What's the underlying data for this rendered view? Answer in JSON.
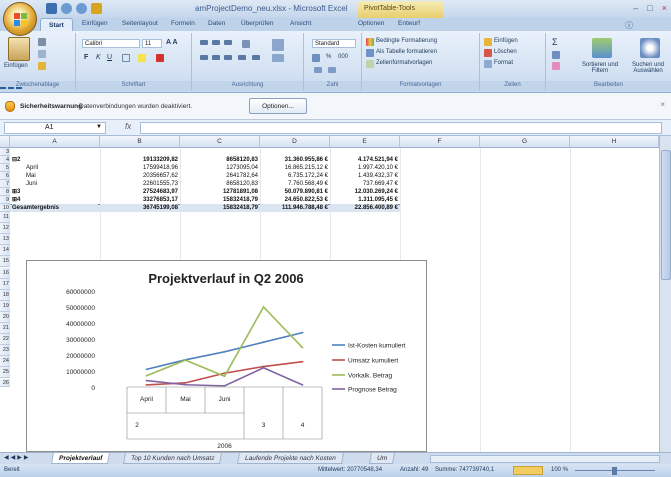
{
  "window": {
    "title": "amProjectDemo_neu.xlsx - Microsoft Excel",
    "context_label": "PivotTable-Tools",
    "minimize": "–",
    "restore": "□",
    "close": "×"
  },
  "ribbon_tabs": [
    "Start",
    "Einfügen",
    "Seitenlayout",
    "Formeln",
    "Daten",
    "Überprüfen",
    "Ansicht",
    "Optionen",
    "Entwurf"
  ],
  "ribbon": {
    "clipboard": {
      "paste": "Einfügen",
      "label": "Zwischenablage"
    },
    "font": {
      "name": "Calibri",
      "size": "11",
      "label": "Schriftart",
      "bold": "F",
      "italic": "K",
      "underline": "U"
    },
    "alignment": {
      "label": "Ausrichtung"
    },
    "number": {
      "format": "Standard",
      "label": "Zahl",
      "percent": "%",
      "thousands": "000"
    },
    "styles": {
      "conditional": "Bedingte Formatierung",
      "as_table": "Als Tabelle formatieren",
      "cell_styles": "Zellenformatvorlagen",
      "label": "Formatvorlagen"
    },
    "cells": {
      "insert": "Einfügen",
      "delete": "Löschen",
      "format": "Format",
      "label": "Zellen"
    },
    "editing": {
      "sigma": "Σ",
      "sort": "Sortieren und Filtern",
      "find": "Suchen und Auswählen",
      "label": "Bearbeiten"
    }
  },
  "security_bar": {
    "title": "Sicherheitswarnung",
    "message": "Datenverbindungen wurden deaktiviert.",
    "button": "Optionen...",
    "close": "×"
  },
  "formula_bar": {
    "cell_ref": "A1",
    "fx": "fx",
    "value": ""
  },
  "columns": [
    "A",
    "B",
    "C",
    "D",
    "E",
    "F",
    "G",
    "H"
  ],
  "rows": [
    {
      "n": "3",
      "a": "",
      "b": "",
      "c": "",
      "d": "",
      "e": "",
      "bold": false,
      "indent": false
    },
    {
      "n": "4",
      "a": "⊟2",
      "b": "19133209,82",
      "c": "8658120,83",
      "d": "31.360.955,86 €",
      "e": "4.174.521,94 €",
      "bold": true,
      "indent": false
    },
    {
      "n": "5",
      "a": "April",
      "b": "17599418,96",
      "c": "1273095,04",
      "d": "16.865.215,12 €",
      "e": "1.997.420,10 €",
      "bold": false,
      "indent": true
    },
    {
      "n": "6",
      "a": "Mai",
      "b": "20356657,62",
      "c": "2641782,64",
      "d": "6.735.172,24 €",
      "e": "1.439.432,37 €",
      "bold": false,
      "indent": true
    },
    {
      "n": "7",
      "a": "Juni",
      "b": "22601555,73",
      "c": "8658120,83",
      "d": "7.760.568,49 €",
      "e": "737.669,47 €",
      "bold": false,
      "indent": true
    },
    {
      "n": "8",
      "a": "⊞3",
      "b": "27524683,97",
      "c": "12781891,08",
      "d": "50.079.890,81 €",
      "e": "12.030.269,24 €",
      "bold": true,
      "indent": false
    },
    {
      "n": "9",
      "a": "⊞4",
      "b": "33276853,17",
      "c": "15832418,79",
      "d": "24.650.822,53 €",
      "e": "1.311.095,45 €",
      "bold": true,
      "indent": false
    },
    {
      "n": "10",
      "a": "Gesamtergebnis",
      "b": "36745199,08",
      "c": "15832418,79",
      "d": "111.946.788,48 €",
      "e": "22.856.400,89 €",
      "bold": true,
      "indent": false
    }
  ],
  "empty_rows": [
    "11",
    "12",
    "13",
    "14",
    "15",
    "16",
    "17",
    "18",
    "19",
    "20",
    "21",
    "22",
    "23",
    "24",
    "25",
    "26"
  ],
  "chart_data": {
    "type": "line",
    "title": "Projektverlauf in Q2 2006",
    "categories": [
      "April",
      "Mai",
      "Juni",
      "3",
      "4"
    ],
    "category_groups": [
      {
        "label": "2",
        "span": 3
      },
      {
        "label": "3",
        "span": 1
      },
      {
        "label": "4",
        "span": 1
      }
    ],
    "year_label": "2006",
    "ylim": [
      0,
      60000000
    ],
    "yticks": [
      "60000000",
      "50000000",
      "40000000",
      "30000000",
      "20000000",
      "10000000",
      "0"
    ],
    "series": [
      {
        "name": "Ist-Kosten kumuliert",
        "color": "#4f81bd",
        "values": [
          11000000,
          17000000,
          22000000,
          28000000,
          34000000
        ]
      },
      {
        "name": "Umsatz kumuliert",
        "color": "#c0504d",
        "values": [
          1300000,
          2600000,
          8600000,
          12800000,
          15800000
        ]
      },
      {
        "name": "Vorkalk. Betrag",
        "color": "#9bbb59",
        "values": [
          7000000,
          16800000,
          6700000,
          50000000,
          24600000
        ]
      },
      {
        "name": "Prognose Betrag",
        "color": "#8064a2",
        "values": [
          4000000,
          1400000,
          700000,
          12000000,
          1300000
        ]
      }
    ]
  },
  "sheet_tabs": [
    "Projektverlauf",
    "Top 10 Kunden nach Umsatz",
    "Laufende Projekte nach Kosten",
    "Um"
  ],
  "status": {
    "mode": "Bereit",
    "average": "Mittelwert: 20770548,34",
    "count": "Anzahl: 49",
    "sum": "Summe: 747739740,1",
    "zoom": "100 %"
  }
}
